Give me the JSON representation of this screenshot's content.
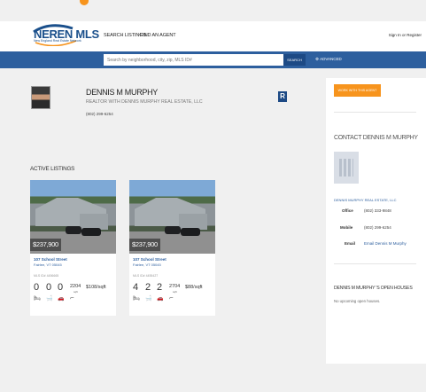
{
  "brand": {
    "logo_text": "NEREN MLS",
    "logo_sub": "New England Real Estate Network",
    "accent": "#f7941d",
    "primary": "#2d5f9e"
  },
  "nav": {
    "search_listings": "SEARCH LISTINGS",
    "find_agent": "FIND AN AGENT",
    "signin": "Sign In or Register"
  },
  "search": {
    "placeholder": "Search by neighborhood, city, zip, MLS ID#",
    "button": "SEARCH",
    "advanced": "ADVANCED",
    "advanced_icon": "gear-icon"
  },
  "agent": {
    "name": "DENNIS M MURPHY",
    "title": "REALTOR WITH DENNIS MURPHY REAL ESTATE, LLC",
    "phone": "(802) 299-6254",
    "realtor_badge": "R"
  },
  "sidebar": {
    "work_button": "WORK WITH THIS AGENT",
    "contact_title": "CONTACT DENNIS M MURPHY",
    "office_name": "DENNIS MURPHY REAL ESTATE, LLC",
    "office_label": "Office",
    "office_phone": "(802) 333-9848",
    "mobile_label": "Mobile",
    "mobile_phone": "(802) 299-6254",
    "email_label": "Email",
    "email_link": "Email Dennis M Murphy",
    "open_houses_title": "DENNIS M MURPHY 'S OPEN HOUSES",
    "open_houses_text": "No upcoming open houses."
  },
  "listings_title": "ACTIVE LISTINGS",
  "listings": [
    {
      "price": "$237,900",
      "address": "107 School Street",
      "city": "Fairlee, VT 05045",
      "mls": "MLS ID# 4456665",
      "beds": "0",
      "baths": "0",
      "garage": "0",
      "sqft": "2204",
      "sqft_unit": "sqft",
      "price_per_sqft": "$108/sqft"
    },
    {
      "price": "$237,900",
      "address": "107 School Street",
      "city": "Fairlee, VT 05045",
      "mls": "MLS ID# 4455427",
      "beds": "4",
      "baths": "2",
      "garage": "2",
      "sqft": "2704",
      "sqft_unit": "sqft",
      "price_per_sqft": "$88/sqft"
    }
  ],
  "card_icons": [
    "bed-icon",
    "bath-icon",
    "car-icon",
    "sqft-icon"
  ]
}
